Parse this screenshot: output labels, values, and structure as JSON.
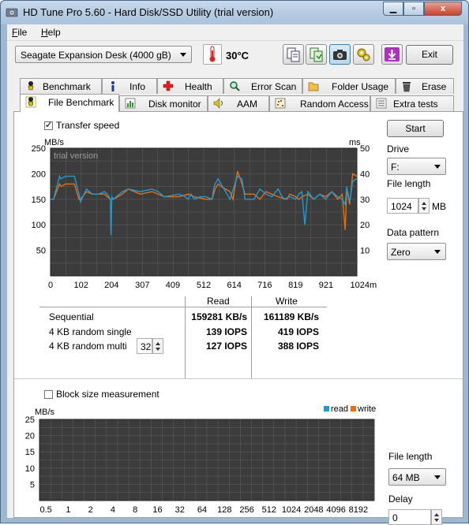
{
  "window": {
    "title": "HD Tune Pro 5.60 - Hard Disk/SSD Utility (trial version)",
    "close_glyph": "x",
    "min_glyph": "▁",
    "max_glyph": "▫"
  },
  "menu": {
    "file_prefix": "F",
    "file_rest": "ile",
    "help_prefix": "H",
    "help_rest": "elp"
  },
  "toolbar": {
    "drive": "Seagate Expansion Desk (4000 gB)",
    "temperature": "30°C",
    "exit_label": "Exit"
  },
  "tabs_top": [
    "Benchmark",
    "Info",
    "Health",
    "Error Scan",
    "Folder Usage",
    "Erase"
  ],
  "tabs_bottom": [
    "File Benchmark",
    "Disk monitor",
    "AAM",
    "Random Access",
    "Extra tests"
  ],
  "transfer": {
    "checkbox_label": "Transfer speed",
    "checked": true
  },
  "side": {
    "start_label": "Start",
    "drive_label": "Drive",
    "drive_value": "F:",
    "file_length_label": "File length",
    "file_length_value": "1024",
    "file_length_unit": "MB",
    "pattern_label": "Data pattern",
    "pattern_value": "Zero"
  },
  "results": {
    "col_read": "Read",
    "col_write": "Write",
    "rows": [
      {
        "label": "Sequential",
        "read": "159281 KB/s",
        "write": "161189 KB/s"
      },
      {
        "label": "4 KB random single",
        "read": "139 IOPS",
        "write": "419 IOPS"
      },
      {
        "label": "4 KB random multi",
        "read": "127 IOPS",
        "write": "388 IOPS"
      }
    ],
    "queue_depth": "32"
  },
  "block": {
    "checkbox_label": "Block size measurement",
    "checked": false,
    "file_length_label": "File length",
    "file_length_value": "64 MB",
    "delay_label": "Delay",
    "delay_value": "0"
  },
  "colors": {
    "read": "#1e9bd7",
    "write": "#e8700e",
    "chart_bg": "#3c3c3c",
    "grid": "#5a5a5a"
  },
  "chart_data": [
    {
      "type": "line",
      "watermark": "trial version",
      "ylabel": "MB/s",
      "y2label": "ms",
      "xunit": "mB",
      "ylim": [
        0,
        250
      ],
      "y2lim": [
        0,
        50
      ],
      "xlim": [
        0,
        1024
      ],
      "x_ticks": [
        "0",
        "102",
        "204",
        "307",
        "409",
        "512",
        "614",
        "716",
        "819",
        "921",
        "1024"
      ],
      "y_ticks": [
        "250",
        "200",
        "150",
        "100",
        "50"
      ],
      "y2_ticks": [
        "50",
        "40",
        "30",
        "20",
        "10"
      ],
      "grid": true,
      "series": [
        {
          "name": "read",
          "x": [
            0,
            10,
            30,
            35,
            50,
            80,
            95,
            100,
            120,
            140,
            160,
            180,
            190,
            200,
            202,
            205,
            210,
            240,
            260,
            300,
            340,
            360,
            380,
            430,
            450,
            460,
            470,
            480,
            500,
            520,
            540,
            545,
            550,
            560,
            570,
            600,
            625,
            640,
            650,
            660,
            680,
            700,
            720,
            740,
            760,
            780,
            800,
            820,
            830,
            840,
            850,
            860,
            880,
            900,
            920,
            940,
            960,
            975,
            985,
            990,
            1000,
            1010,
            1024
          ],
          "values": [
            150,
            150,
            195,
            190,
            195,
            195,
            160,
            145,
            170,
            160,
            160,
            165,
            160,
            150,
            80,
            155,
            150,
            165,
            170,
            165,
            170,
            165,
            155,
            160,
            155,
            150,
            160,
            150,
            155,
            155,
            150,
            170,
            180,
            190,
            180,
            150,
            195,
            190,
            150,
            150,
            150,
            170,
            160,
            155,
            170,
            150,
            155,
            150,
            160,
            165,
            100,
            165,
            150,
            160,
            150,
            165,
            155,
            150,
            140,
            175,
            145,
            185,
            190
          ]
        },
        {
          "name": "write",
          "x": [
            0,
            10,
            30,
            35,
            50,
            80,
            95,
            100,
            120,
            140,
            160,
            180,
            200,
            205,
            210,
            240,
            260,
            300,
            340,
            380,
            430,
            460,
            480,
            520,
            540,
            550,
            560,
            570,
            600,
            610,
            625,
            640,
            650,
            680,
            700,
            720,
            740,
            760,
            790,
            800,
            820,
            830,
            840,
            860,
            880,
            900,
            920,
            940,
            960,
            975,
            985,
            990,
            1000,
            1010,
            1024
          ],
          "values": [
            150,
            150,
            180,
            175,
            180,
            180,
            150,
            150,
            165,
            160,
            160,
            160,
            150,
            150,
            150,
            160,
            170,
            160,
            165,
            155,
            155,
            160,
            155,
            150,
            150,
            170,
            180,
            175,
            165,
            150,
            205,
            180,
            160,
            160,
            150,
            165,
            160,
            155,
            150,
            160,
            155,
            150,
            155,
            160,
            150,
            160,
            155,
            165,
            150,
            160,
            90,
            170,
            140,
            200,
            195
          ]
        }
      ]
    },
    {
      "type": "bar",
      "ylabel": "MB/s",
      "ylim": [
        0,
        25
      ],
      "y_ticks": [
        "25",
        "20",
        "15",
        "10",
        "5"
      ],
      "categories": [
        "0.5",
        "1",
        "2",
        "4",
        "8",
        "16",
        "32",
        "64",
        "128",
        "256",
        "512",
        "1024",
        "2048",
        "4096",
        "8192"
      ],
      "legend": [
        "read",
        "write"
      ],
      "legend_position": "top-right",
      "grid": true,
      "series": []
    }
  ]
}
